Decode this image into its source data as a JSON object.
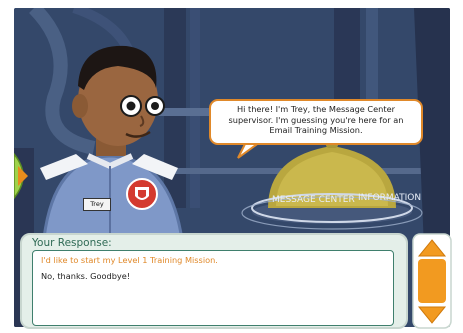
{
  "scene": {
    "character_name": "Trey",
    "console_text": "MESSAGE CENTER",
    "console_text_2": "INFORMATION",
    "speech": "Hi there! I'm Trey, the Message Center supervisor. I'm guessing you're here for an Email Training Mission."
  },
  "dialog": {
    "label": "Your Response:",
    "options": [
      "I'd like to start my Level 1 Training Mission.",
      "No, thanks. Goodbye!"
    ]
  },
  "colors": {
    "accent": "#e0892a",
    "teal": "#3f7f6d",
    "scroll": "#f29a20"
  },
  "icons": {
    "back": "arrow-left-icon",
    "scroll_up": "chevron-up-icon",
    "scroll_down": "chevron-down-icon"
  }
}
